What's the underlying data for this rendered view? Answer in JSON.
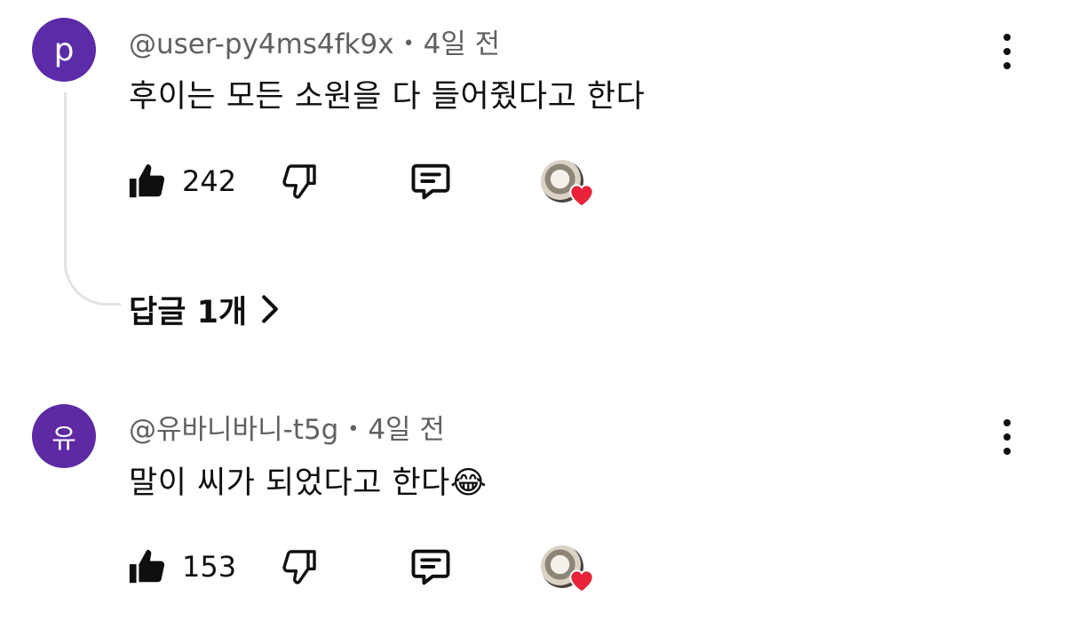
{
  "comments": [
    {
      "avatar_letter": "p",
      "author": "@user-py4ms4fk9x",
      "time": "4일 전",
      "text": "후이는 모든 소원을 다 들어줬다고 한다",
      "likes": "242",
      "replies_label": "답글 1개"
    },
    {
      "avatar_letter": "유",
      "author": "@유바니바니-t5g",
      "time": "4일 전",
      "text": "말이 씨가 되었다고 한다",
      "emoji": "😂",
      "likes": "153"
    }
  ],
  "separator": "•",
  "icons": {
    "like": "thumbs-up-icon",
    "dislike": "thumbs-down-icon",
    "reply": "comment-icon",
    "menu": "kebab-menu-icon",
    "creator_heart": "creator-heart-icon",
    "replies_chevron": "chevron-right-icon"
  },
  "colors": {
    "avatar_bg": "#5b2ba8",
    "heart": "#e8233a",
    "meta_text": "#606060",
    "thread_line": "#e2e2e2"
  }
}
